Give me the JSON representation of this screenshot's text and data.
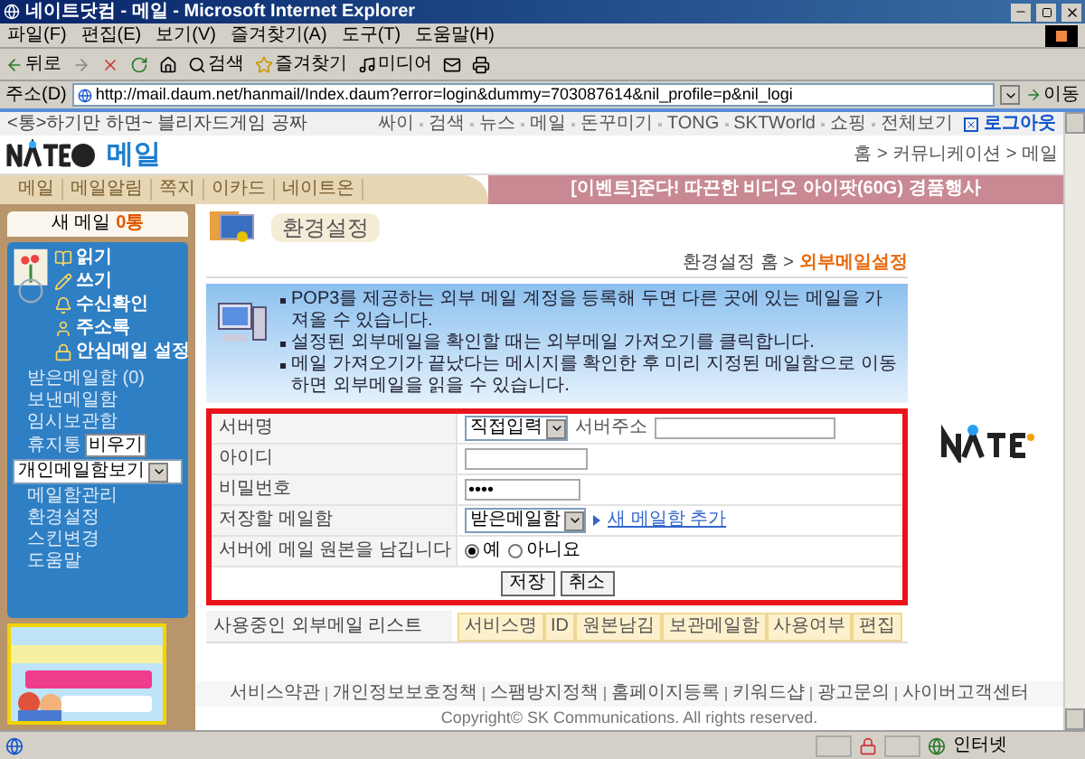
{
  "window": {
    "title": "네이트닷컴 - 메일 - Microsoft Internet Explorer"
  },
  "menu_bar": [
    "파일(F)",
    "편집(E)",
    "보기(V)",
    "즐겨찾기(A)",
    "도구(T)",
    "도움말(H)"
  ],
  "toolbar": {
    "back": "뒤로",
    "search": "검색",
    "favorites": "즐겨찾기",
    "media": "미디어"
  },
  "address_bar": {
    "label": "주소(D)",
    "url": "http://mail.daum.net/hanmail/Index.daum?error=login&dummy=703087614&nil_profile=p&nil_logi",
    "go": "이동"
  },
  "top_strip": {
    "promo": "<통>하기만 하면~ 블리자드게임 공짜",
    "links": [
      "싸이",
      "검색",
      "뉴스",
      "메일",
      "돈꾸미기",
      "TONG",
      "SKTWorld",
      "쇼핑",
      "전체보기"
    ],
    "logout": "로그아웃"
  },
  "header": {
    "service": "메일",
    "breadcrumb": "홈 > 커뮤니케이션 > 메일"
  },
  "nav_tabs": [
    {
      "label": "메일",
      "selected": false
    },
    {
      "label": "메일알림",
      "selected": false
    },
    {
      "label": "쪽지",
      "selected": false
    },
    {
      "label": "이카드",
      "selected": false
    },
    {
      "label": "네이트온",
      "selected": false
    }
  ],
  "event_banner": "[이벤트]준다! 따끈한 비디오 아이팟(60G) 경품행사",
  "sidebar": {
    "new_mail_label": "새 메일",
    "new_mail_count": "0통",
    "actions": [
      {
        "label": "읽기",
        "kind": "read"
      },
      {
        "label": "쓰기",
        "kind": "write"
      },
      {
        "label": "수신확인",
        "kind": "receipt"
      },
      {
        "label": "주소록",
        "kind": "contacts"
      },
      {
        "label": "안심메일 설정",
        "kind": "secure"
      }
    ],
    "folders": [
      "받은메일함 (0)",
      "보낸메일함",
      "임시보관함",
      "휴지통"
    ],
    "empty_button": "비우기",
    "folder_select": "개인메일함보기",
    "links": [
      "메일함관리",
      "환경설정",
      "스킨변경",
      "도움말"
    ]
  },
  "page": {
    "title": "환경설정",
    "crumb": "환경설정 홈 >",
    "current": "외부메일설정",
    "info": [
      "POP3를 제공하는 외부 메일 계정을 등록해 두면 다른 곳에 있는 메일을 가져올 수 있습니다.",
      "설정된 외부메일을 확인할 때는 외부메일 가져오기를 클릭합니다.",
      "메일 가져오기가 끝났다는 메시지를 확인한 후 미리 지정된 메일함으로 이동하면 외부메일을 읽을 수 있습니다."
    ]
  },
  "form": {
    "server_label": "서버명",
    "server_select": "직접입력",
    "server_address_label": "서버주소",
    "id_label": "아이디",
    "password_label": "비밀번호",
    "password_value": "••••",
    "mailbox_label": "저장할 메일함",
    "mailbox_select": "받은메일함",
    "add_mailbox": "새 메일함 추가",
    "keep_label": "서버에 메일 원본을 남깁니다",
    "keep_options": [
      {
        "label": "예",
        "selected": true
      },
      {
        "label": "아니요",
        "selected": false
      }
    ],
    "buttons": [
      "저장",
      "취소"
    ]
  },
  "list": {
    "label": "사용중인 외부메일 리스트",
    "columns": [
      "서비스명",
      "ID",
      "원본남김",
      "보관메일함",
      "사용여부",
      "편집"
    ]
  },
  "footer": {
    "links": [
      "서비스약관",
      "개인정보보호정책",
      "스팸방지정책",
      "홈페이지등록",
      "키워드샵",
      "광고문의",
      "사이버고객센터"
    ],
    "copyright": "Copyright© SK Communications. All rights reserved."
  },
  "status_bar": {
    "zone": "인터넷"
  }
}
